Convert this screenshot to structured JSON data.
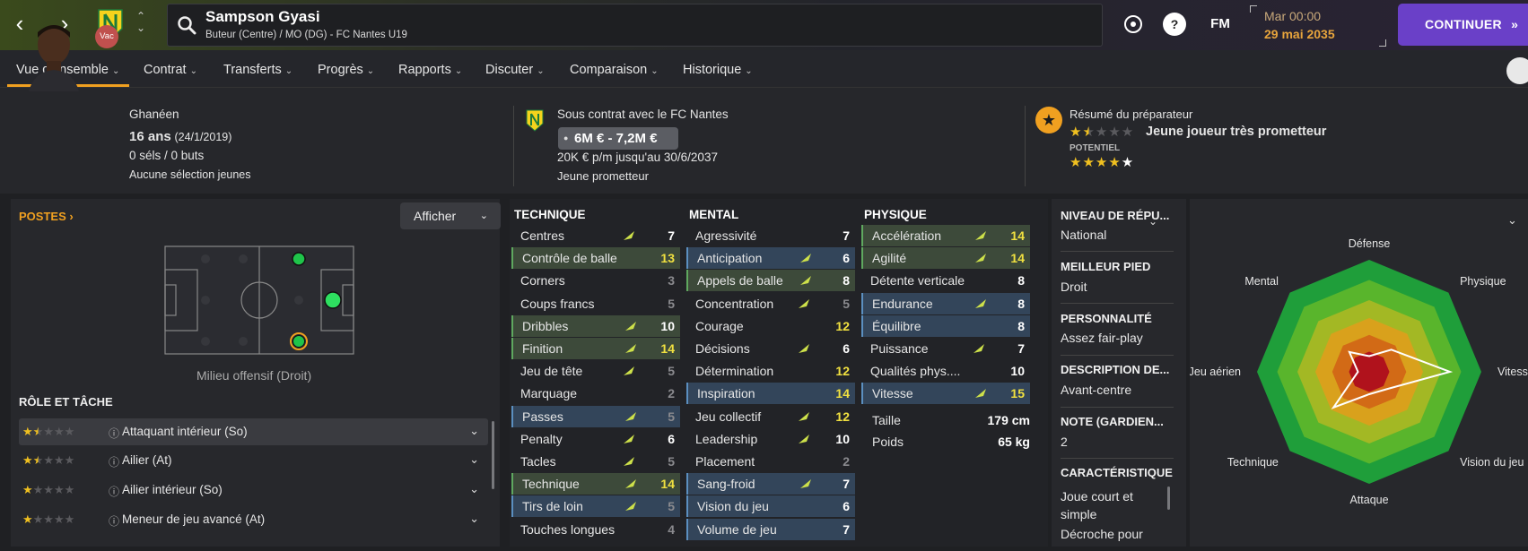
{
  "header": {
    "player_name": "Sampson Gyasi",
    "player_subtitle": "Buteur (Centre) / MO (DG) - FC Nantes U19",
    "help_label": "?",
    "fm_label": "FM",
    "date_time": "Mar 00:00",
    "date_day": "29 mai 2035",
    "continue_label": "CONTINUER",
    "icons": [
      "back-icon",
      "forward-icon",
      "club-badge-icon",
      "search-icon",
      "ball-icon",
      "help-icon"
    ]
  },
  "tabs": [
    {
      "label": "Vue d'ensemble"
    },
    {
      "label": "Contrat"
    },
    {
      "label": "Transferts"
    },
    {
      "label": "Progrès"
    },
    {
      "label": "Rapports"
    },
    {
      "label": "Discuter"
    },
    {
      "label": "Comparaison"
    },
    {
      "label": "Historique"
    }
  ],
  "summary": {
    "nationality": "Ghanéen",
    "vac_badge": "Vac",
    "age": "16 ans",
    "dob": "(24/1/2019)",
    "caps": "0 séls / 0 buts",
    "youth": "Aucune sélection jeunes",
    "contract_with": "Sous contrat avec le FC Nantes",
    "value_range": "6M € - 7,2M €",
    "wage": "20K € p/m jusqu'au 30/6/2037",
    "contract_status": "Jeune prometteur",
    "coach_summary_title": "Résumé du préparateur",
    "coach_summary": "Jeune joueur très prometteur",
    "ability_stars": 1.5,
    "potential_label": "POTENTIEL",
    "potential_stars": 4.5
  },
  "positions": {
    "title": "POSTES",
    "display_button": "Afficher",
    "position_label": "Milieu offensif (Droit)"
  },
  "roles": {
    "title": "RÔLE ET TÂCHE",
    "items": [
      {
        "label": "Attaquant intérieur (So)",
        "stars": 1.5
      },
      {
        "label": "Ailier (At)",
        "stars": 1.5
      },
      {
        "label": "Ailier intérieur (So)",
        "stars": 1
      },
      {
        "label": "Meneur de jeu avancé (At)",
        "stars": 1
      }
    ]
  },
  "attributes": {
    "technique": {
      "title": "TECHNIQUE",
      "items": [
        {
          "label": "Centres",
          "value": 7,
          "hl": "",
          "arrow": true
        },
        {
          "label": "Contrôle de balle",
          "value": 13,
          "hl": "green",
          "arrow": false
        },
        {
          "label": "Corners",
          "value": 3,
          "hl": "",
          "arrow": false
        },
        {
          "label": "Coups francs",
          "value": 5,
          "hl": "",
          "arrow": false
        },
        {
          "label": "Dribbles",
          "value": 10,
          "hl": "green",
          "arrow": true
        },
        {
          "label": "Finition",
          "value": 14,
          "hl": "green",
          "arrow": true
        },
        {
          "label": "Jeu de tête",
          "value": 5,
          "hl": "",
          "arrow": true
        },
        {
          "label": "Marquage",
          "value": 2,
          "hl": "",
          "arrow": false
        },
        {
          "label": "Passes",
          "value": 5,
          "hl": "blue",
          "arrow": true
        },
        {
          "label": "Penalty",
          "value": 6,
          "hl": "",
          "arrow": true
        },
        {
          "label": "Tacles",
          "value": 5,
          "hl": "",
          "arrow": true
        },
        {
          "label": "Technique",
          "value": 14,
          "hl": "green",
          "arrow": true
        },
        {
          "label": "Tirs de loin",
          "value": 5,
          "hl": "blue",
          "arrow": true
        },
        {
          "label": "Touches longues",
          "value": 4,
          "hl": "",
          "arrow": false
        }
      ]
    },
    "mental": {
      "title": "MENTAL",
      "items": [
        {
          "label": "Agressivité",
          "value": 7,
          "hl": "",
          "arrow": false
        },
        {
          "label": "Anticipation",
          "value": 6,
          "hl": "blue",
          "arrow": true
        },
        {
          "label": "Appels de balle",
          "value": 8,
          "hl": "green",
          "arrow": true
        },
        {
          "label": "Concentration",
          "value": 5,
          "hl": "",
          "arrow": true
        },
        {
          "label": "Courage",
          "value": 12,
          "hl": "",
          "arrow": false
        },
        {
          "label": "Décisions",
          "value": 6,
          "hl": "",
          "arrow": true
        },
        {
          "label": "Détermination",
          "value": 12,
          "hl": "",
          "arrow": false
        },
        {
          "label": "Inspiration",
          "value": 14,
          "hl": "blue",
          "arrow": false
        },
        {
          "label": "Jeu collectif",
          "value": 12,
          "hl": "",
          "arrow": true
        },
        {
          "label": "Leadership",
          "value": 10,
          "hl": "",
          "arrow": true
        },
        {
          "label": "Placement",
          "value": 2,
          "hl": "",
          "arrow": false
        },
        {
          "label": "Sang-froid",
          "value": 7,
          "hl": "blue",
          "arrow": true
        },
        {
          "label": "Vision du jeu",
          "value": 6,
          "hl": "blue",
          "arrow": false
        },
        {
          "label": "Volume de jeu",
          "value": 7,
          "hl": "blue",
          "arrow": false
        }
      ]
    },
    "physique": {
      "title": "PHYSIQUE",
      "items": [
        {
          "label": "Accélération",
          "value": 14,
          "hl": "green",
          "arrow": true
        },
        {
          "label": "Agilité",
          "value": 14,
          "hl": "green",
          "arrow": true
        },
        {
          "label": "Détente verticale",
          "value": 8,
          "hl": "",
          "arrow": false
        },
        {
          "label": "Endurance",
          "value": 8,
          "hl": "blue",
          "arrow": true
        },
        {
          "label": "Équilibre",
          "value": 8,
          "hl": "blue",
          "arrow": false
        },
        {
          "label": "Puissance",
          "value": 7,
          "hl": "",
          "arrow": true
        },
        {
          "label": "Qualités phys....",
          "value": 10,
          "hl": "",
          "arrow": false
        },
        {
          "label": "Vitesse",
          "value": 15,
          "hl": "blue",
          "arrow": true
        }
      ],
      "height_label": "Taille",
      "height_value": "179 cm",
      "weight_label": "Poids",
      "weight_value": "65 kg"
    }
  },
  "info": {
    "reputation_title": "NIVEAU DE RÉPU...",
    "reputation_value": "National",
    "foot_title": "MEILLEUR PIED",
    "foot_value": "Droit",
    "personality_title": "PERSONNALITÉ",
    "personality_value": "Assez fair-play",
    "description_title": "DESCRIPTION DE...",
    "description_value": "Avant-centre",
    "gk_title": "NOTE (GARDIEN...",
    "gk_value": "2",
    "traits_title": "CARACTÉRISTIQUE",
    "traits_line1": "Joue court et",
    "traits_line2": "simple",
    "traits_line3": "Décroche pour"
  },
  "radar": {
    "labels": [
      "Défense",
      "Physique",
      "Vitesse",
      "Vision du jeu",
      "Attaque",
      "Technique",
      "Jeu aérien",
      "Mental"
    ],
    "values": [
      0.14,
      0.28,
      0.72,
      0.22,
      0.2,
      0.45,
      0.1,
      0.25
    ],
    "colors": {
      "outer": "#1f9e3a",
      "mid1": "#59b52c",
      "mid2": "#a3b824",
      "mid3": "#d9a11c",
      "mid4": "#d26a16",
      "inner": "#b0121c",
      "shape": "#ffffff"
    }
  },
  "colors": {
    "accent": "#f0a020",
    "continue": "#6a40c8",
    "highlight_green": "#3d4a3a",
    "highlight_blue": "#33455a",
    "value_yellow": "#f0e040"
  }
}
